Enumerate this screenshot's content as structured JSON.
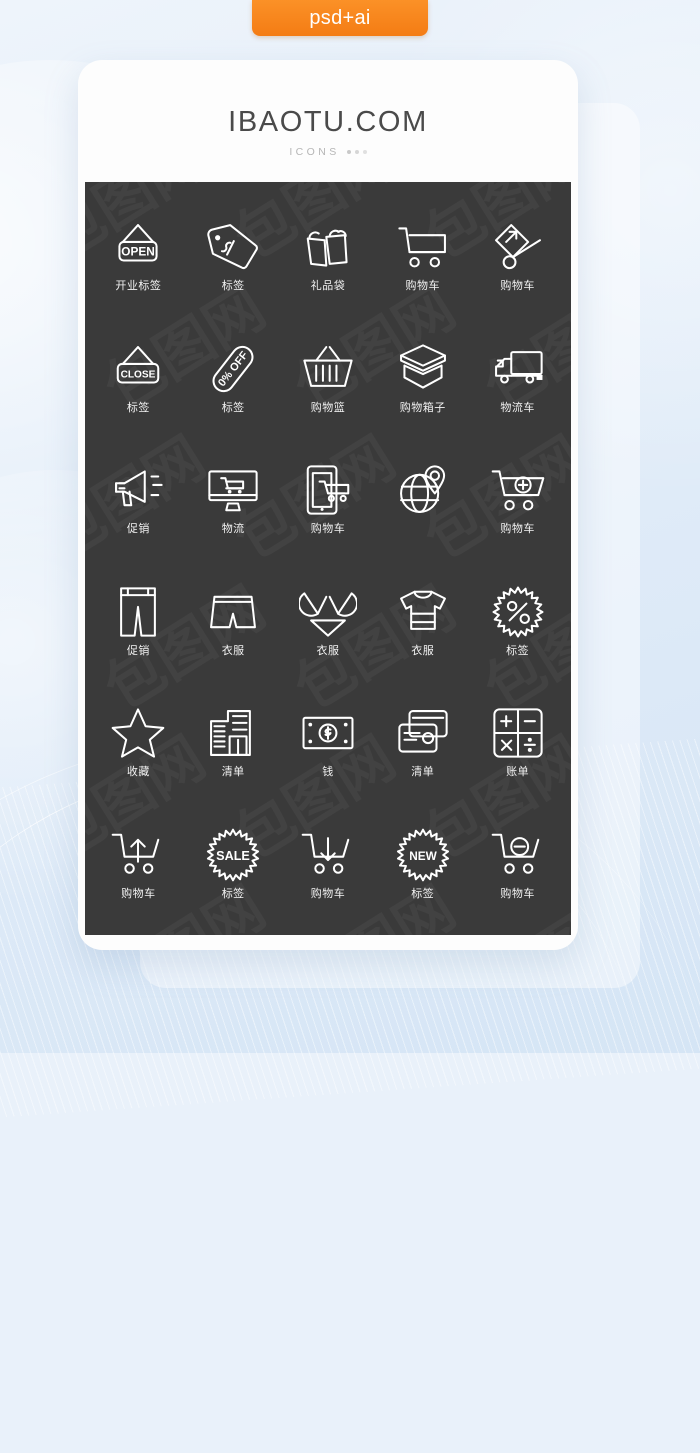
{
  "badge": {
    "label": "psd+ai",
    "color": "#f47c14"
  },
  "brand": {
    "title": "IBAOTU.COM",
    "subtitle": "ICONS"
  },
  "panel": {
    "background": "#3a3a3a",
    "icon_color": "#ffffff"
  },
  "watermark": {
    "text": "包图网"
  },
  "icons": [
    {
      "name": "open-sign-icon",
      "label": "开业标签",
      "glyph": "open-sign"
    },
    {
      "name": "price-tag-dollar-icon",
      "label": "标签",
      "glyph": "tag-dollar"
    },
    {
      "name": "gift-bags-icon",
      "label": "礼品袋",
      "glyph": "gift-bags"
    },
    {
      "name": "shopping-cart-icon",
      "label": "购物车",
      "glyph": "cart"
    },
    {
      "name": "hand-truck-icon",
      "label": "购物车",
      "glyph": "hand-truck"
    },
    {
      "name": "close-sign-icon",
      "label": "标签",
      "glyph": "close-sign"
    },
    {
      "name": "percent-off-tag-icon",
      "label": "标签",
      "glyph": "tag-off"
    },
    {
      "name": "shopping-basket-icon",
      "label": "购物篮",
      "glyph": "basket"
    },
    {
      "name": "open-box-icon",
      "label": "购物箱子",
      "glyph": "open-box"
    },
    {
      "name": "delivery-truck-icon",
      "label": "物流车",
      "glyph": "truck"
    },
    {
      "name": "megaphone-icon",
      "label": "促销",
      "glyph": "megaphone"
    },
    {
      "name": "desktop-cart-icon",
      "label": "物流",
      "glyph": "monitor-cart"
    },
    {
      "name": "mobile-cart-icon",
      "label": "购物车",
      "glyph": "phone-cart"
    },
    {
      "name": "globe-location-icon",
      "label": "",
      "glyph": "globe-pin"
    },
    {
      "name": "cart-add-icon",
      "label": "购物车",
      "glyph": "cart-plus"
    },
    {
      "name": "pants-icon",
      "label": "促销",
      "glyph": "pants"
    },
    {
      "name": "shorts-icon",
      "label": "衣服",
      "glyph": "shorts"
    },
    {
      "name": "bikini-icon",
      "label": "衣服",
      "glyph": "bikini"
    },
    {
      "name": "tshirt-icon",
      "label": "衣服",
      "glyph": "tshirt"
    },
    {
      "name": "percent-badge-icon",
      "label": "标签",
      "glyph": "percent-badge"
    },
    {
      "name": "star-favorite-icon",
      "label": "收藏",
      "glyph": "star"
    },
    {
      "name": "building-list-icon",
      "label": "清单",
      "glyph": "building"
    },
    {
      "name": "banknote-icon",
      "label": "钱",
      "glyph": "money"
    },
    {
      "name": "credit-cards-icon",
      "label": "清单",
      "glyph": "cards"
    },
    {
      "name": "calculator-icon",
      "label": "账单",
      "glyph": "calculator"
    },
    {
      "name": "cart-upload-icon",
      "label": "购物车",
      "glyph": "cart-up"
    },
    {
      "name": "sale-badge-icon",
      "label": "标签",
      "glyph": "sale-badge"
    },
    {
      "name": "cart-download-icon",
      "label": "购物车",
      "glyph": "cart-down"
    },
    {
      "name": "new-badge-icon",
      "label": "标签",
      "glyph": "new-badge"
    },
    {
      "name": "cart-remove-icon",
      "label": "购物车",
      "glyph": "cart-minus"
    }
  ],
  "badge_texts": {
    "open": "OPEN",
    "close": "CLOSE",
    "off": "0% OFF",
    "sale": "SALE",
    "new": "NEW"
  }
}
